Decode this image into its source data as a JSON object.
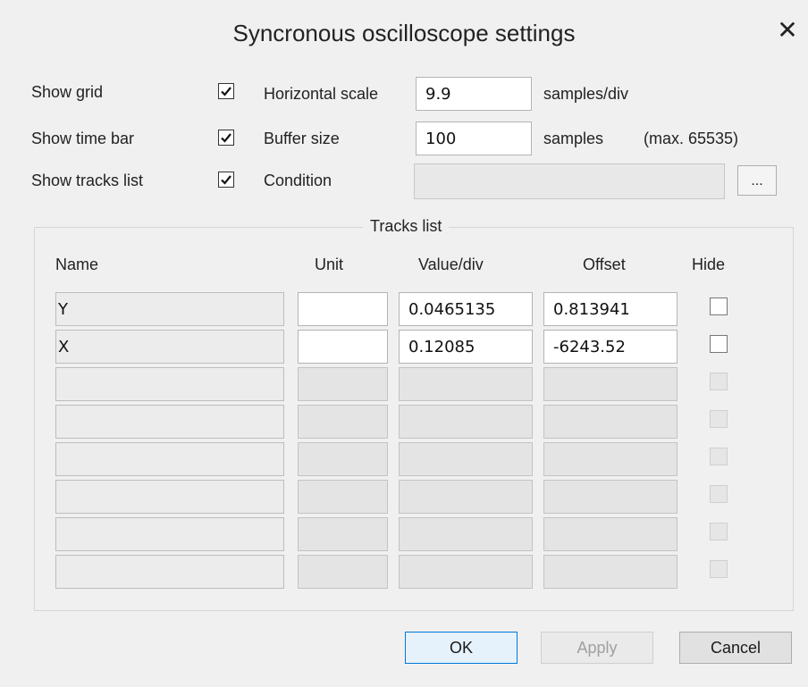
{
  "dialog": {
    "title": "Syncronous oscilloscope settings",
    "close": "✕"
  },
  "options": {
    "show_grid": {
      "label": "Show grid",
      "checked": true
    },
    "show_time_bar": {
      "label": "Show time bar",
      "checked": true
    },
    "show_tracks_list": {
      "label": "Show tracks list",
      "checked": true
    }
  },
  "settings": {
    "horizontal_scale": {
      "label": "Horizontal scale",
      "value": "9.9",
      "unit": "samples/div"
    },
    "buffer_size": {
      "label": "Buffer size",
      "value": "100",
      "unit": "samples",
      "max_note": "(max. 65535)"
    },
    "condition": {
      "label": "Condition",
      "value": "",
      "browse_label": "..."
    }
  },
  "tracks": {
    "group_title": "Tracks list",
    "columns": {
      "name": "Name",
      "unit": "Unit",
      "value_div": "Value/div",
      "offset": "Offset",
      "hide": "Hide"
    },
    "rows": [
      {
        "name": "Y",
        "unit": "",
        "value_div": "0.0465135",
        "offset": "0.813941",
        "hide": false,
        "enabled": true
      },
      {
        "name": "X",
        "unit": "",
        "value_div": "0.12085",
        "offset": "-6243.52",
        "hide": false,
        "enabled": true
      },
      {
        "name": "",
        "unit": "",
        "value_div": "",
        "offset": "",
        "hide": false,
        "enabled": false
      },
      {
        "name": "",
        "unit": "",
        "value_div": "",
        "offset": "",
        "hide": false,
        "enabled": false
      },
      {
        "name": "",
        "unit": "",
        "value_div": "",
        "offset": "",
        "hide": false,
        "enabled": false
      },
      {
        "name": "",
        "unit": "",
        "value_div": "",
        "offset": "",
        "hide": false,
        "enabled": false
      },
      {
        "name": "",
        "unit": "",
        "value_div": "",
        "offset": "",
        "hide": false,
        "enabled": false
      },
      {
        "name": "",
        "unit": "",
        "value_div": "",
        "offset": "",
        "hide": false,
        "enabled": false
      }
    ]
  },
  "buttons": {
    "ok": "OK",
    "apply": "Apply",
    "cancel": "Cancel"
  }
}
